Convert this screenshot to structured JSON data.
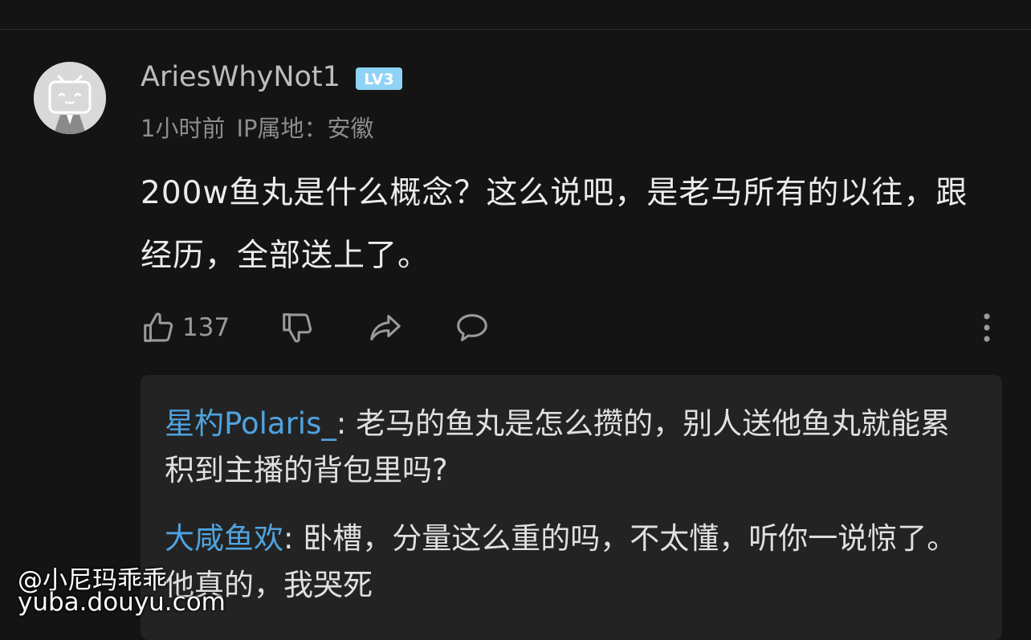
{
  "comment": {
    "username": "AriesWhyNot1",
    "level_badge": "LV3",
    "time": "1小时前",
    "ip_location": "IP属地：安徽",
    "content": "200w鱼丸是什么概念？这么说吧，是老马所有的以往，跟经历，全部送上了。",
    "like_count": "137",
    "icons": [
      "thumbs-up-icon",
      "thumbs-down-icon",
      "share-icon",
      "comment-icon",
      "more-icon"
    ]
  },
  "replies": [
    {
      "author": "星杓Polaris_",
      "separator": ": ",
      "text": "老马的鱼丸是怎么攒的，别人送他鱼丸就能累积到主播的背包里吗?"
    },
    {
      "author": "大咸鱼欢",
      "separator": ": ",
      "text": "卧槽，分量这么重的吗，不太懂，听你一说惊了。他真的，我哭死"
    }
  ],
  "watermark": {
    "handle": "@小尼玛乖乖",
    "site": "yuba.douyu.com"
  },
  "colors": {
    "background": "#141414",
    "reply_background": "#232323",
    "reply_author": "#4fa3e0",
    "badge": "#8fd3f5"
  }
}
